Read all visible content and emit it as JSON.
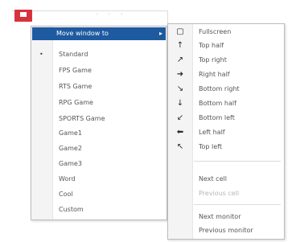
{
  "colors": {
    "highlight": "#1e5aa0",
    "app_icon": "#d8323c",
    "disabled_text": "#b6b6b6"
  },
  "left_menu": {
    "highlighted": {
      "label": "Move window to",
      "arrow": "▸"
    },
    "checkmark": "•",
    "items": [
      {
        "label": "Standard",
        "checked": true
      },
      {
        "label": "FPS Game"
      },
      {
        "label": "RTS Game"
      },
      {
        "label": "RPG Game"
      },
      {
        "label": "SPORTS Game"
      },
      {
        "label": "Game1"
      },
      {
        "label": "Game2"
      },
      {
        "label": "Game3"
      },
      {
        "label": "Word"
      },
      {
        "label": "Cool"
      },
      {
        "label": "Custom"
      }
    ]
  },
  "right_menu": {
    "items": [
      {
        "label": "Fullscreen",
        "icon": "fullscreen-icon",
        "glyph": "▢"
      },
      {
        "label": "Top half",
        "icon": "top-half-icon",
        "glyph": "↑"
      },
      {
        "label": "Top right",
        "icon": "top-right-icon",
        "glyph": "↗"
      },
      {
        "label": "Right half",
        "icon": "right-half-icon",
        "glyph": "➜"
      },
      {
        "label": "Bottom right",
        "icon": "bottom-right-icon",
        "glyph": "↘"
      },
      {
        "label": "Bottom half",
        "icon": "bottom-half-icon",
        "glyph": "↓"
      },
      {
        "label": "Bottom left",
        "icon": "bottom-left-icon",
        "glyph": "↙"
      },
      {
        "label": "Left half",
        "icon": "left-half-icon",
        "glyph": "⬅"
      },
      {
        "label": "Top left",
        "icon": "top-left-icon",
        "glyph": "↖"
      }
    ],
    "cell_items": [
      {
        "label": "Next cell",
        "disabled": false
      },
      {
        "label": "Previous cell",
        "disabled": true
      }
    ],
    "monitor_items": [
      {
        "label": "Next monitor",
        "disabled": false
      },
      {
        "label": "Previous monitor",
        "disabled": false
      }
    ]
  }
}
